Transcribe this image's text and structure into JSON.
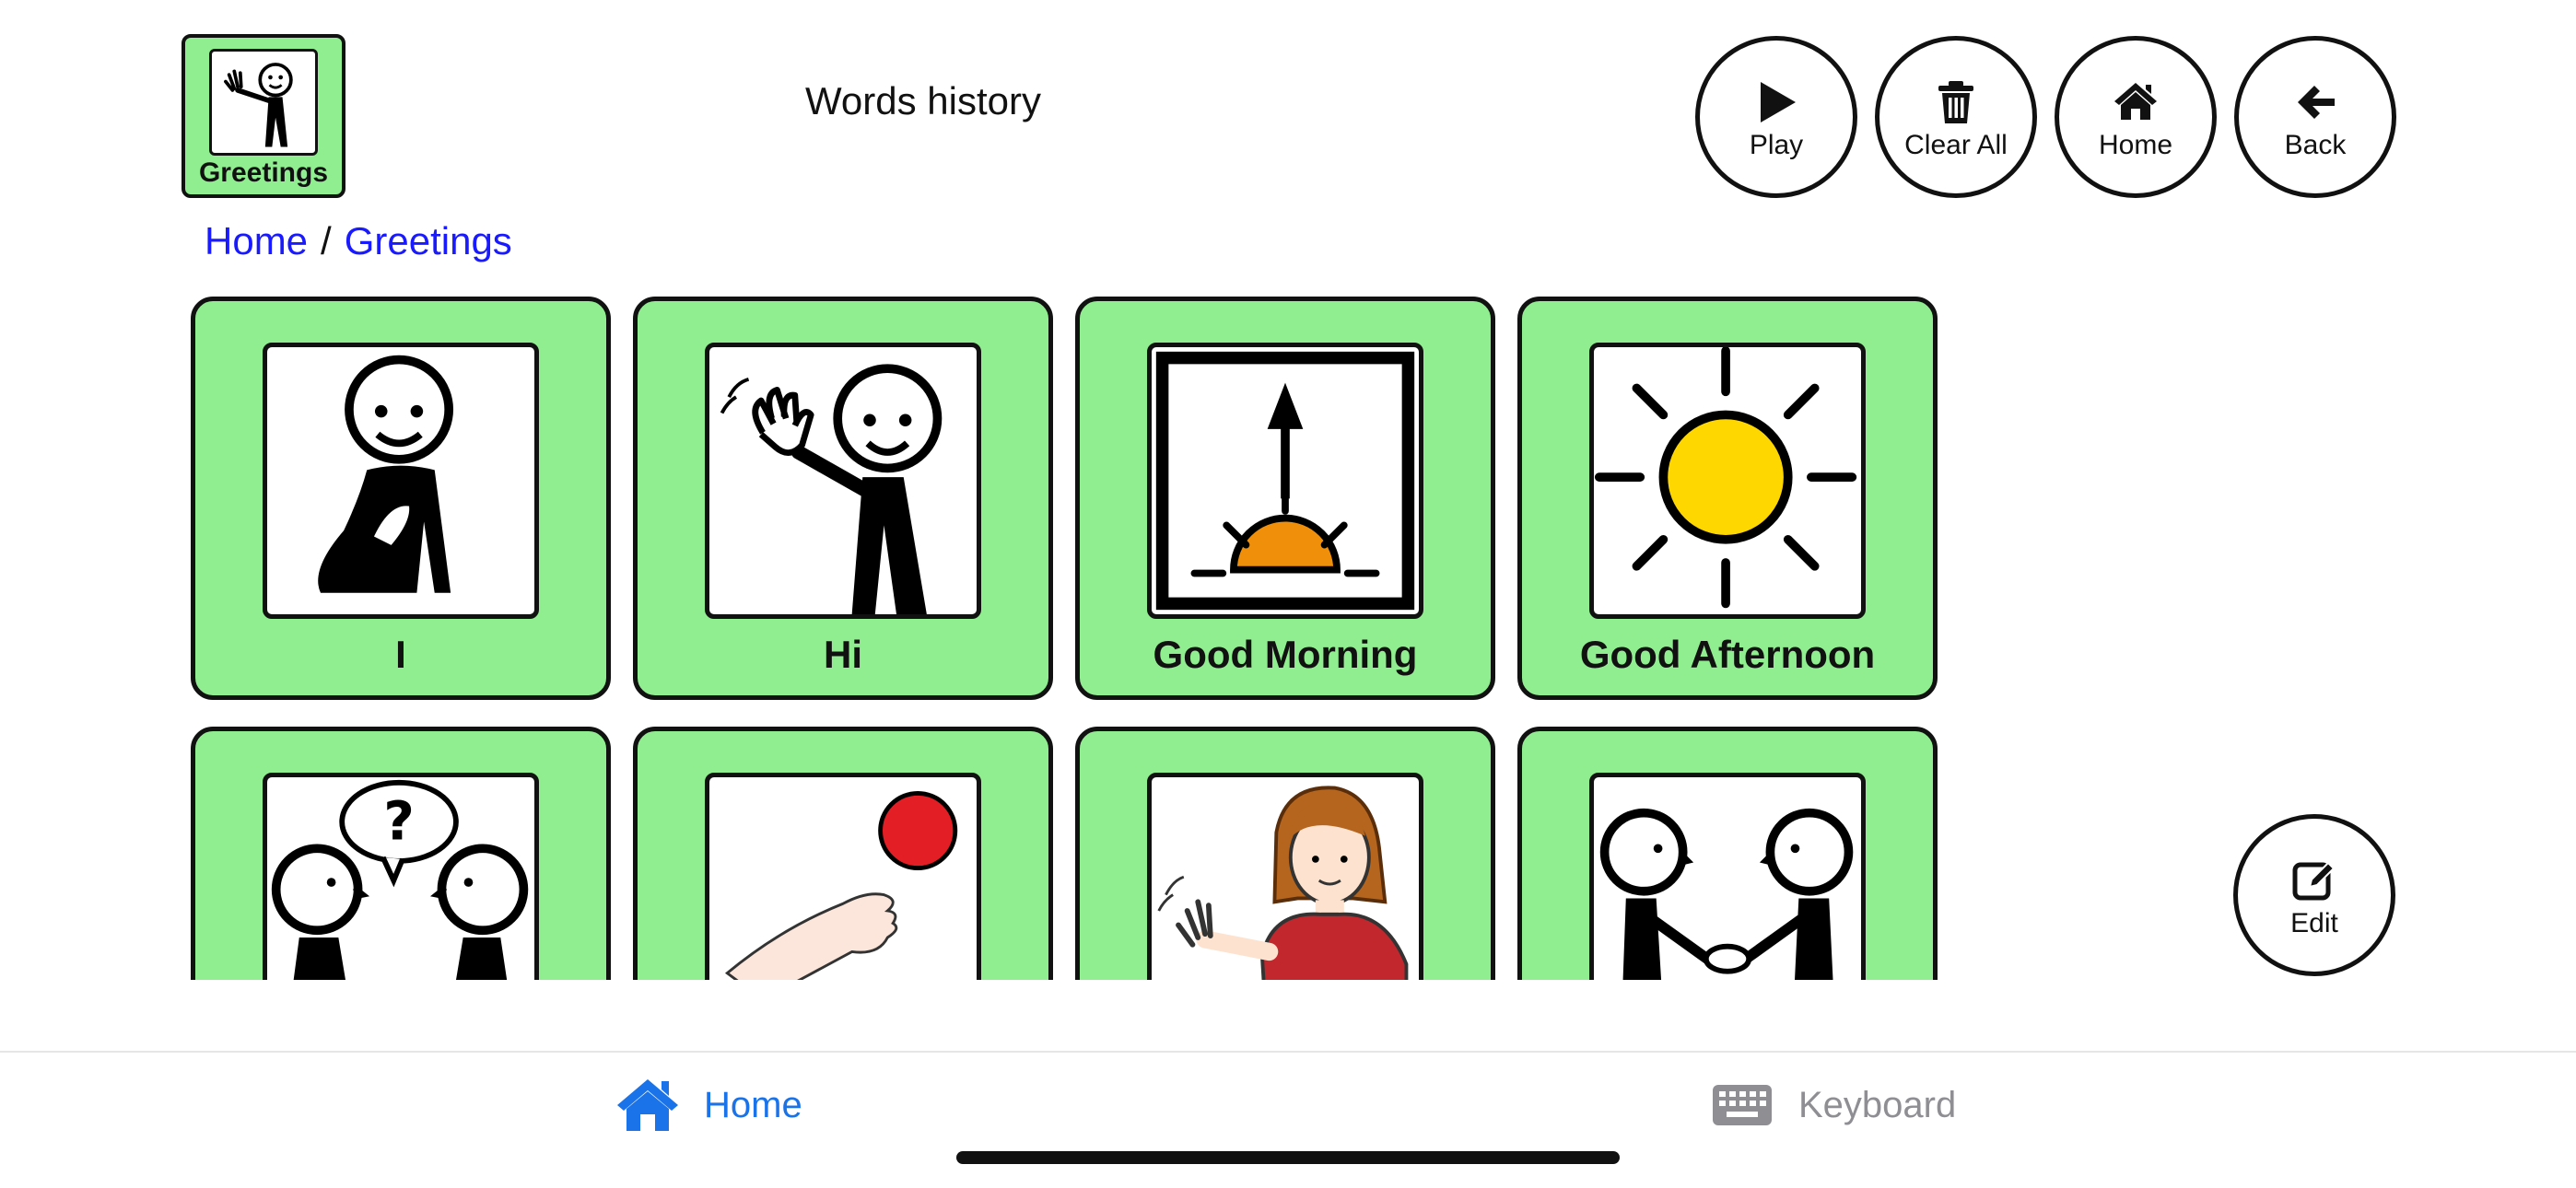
{
  "header": {
    "current_board_label": "Greetings",
    "history_title": "Words history"
  },
  "toolbar": {
    "play_label": "Play",
    "clear_all_label": "Clear All",
    "home_label": "Home",
    "back_label": "Back"
  },
  "breadcrumb": {
    "items": [
      "Home",
      "Greetings"
    ],
    "separator": "/"
  },
  "tiles": [
    {
      "label": "I",
      "icon": "person-pointing-self-icon"
    },
    {
      "label": "Hi",
      "icon": "person-waving-icon"
    },
    {
      "label": "Good Morning",
      "icon": "sunrise-icon"
    },
    {
      "label": "Good Afternoon",
      "icon": "sun-icon"
    },
    {
      "label": "",
      "icon": "two-people-question-icon"
    },
    {
      "label": "",
      "icon": "hand-reaching-ball-icon"
    },
    {
      "label": "",
      "icon": "girl-waving-icon"
    },
    {
      "label": "",
      "icon": "handshake-icon"
    }
  ],
  "edit": {
    "label": "Edit"
  },
  "tabbar": {
    "home_label": "Home",
    "keyboard_label": "Keyboard"
  },
  "colors": {
    "tile_background": "#90ee90",
    "link": "#1a1aff",
    "tab_active": "#1a73e8",
    "tab_inactive": "#8e8e93",
    "sun_yellow": "#ffd700",
    "sunrise_orange": "#f0900a",
    "ball_red": "#e31e24"
  }
}
